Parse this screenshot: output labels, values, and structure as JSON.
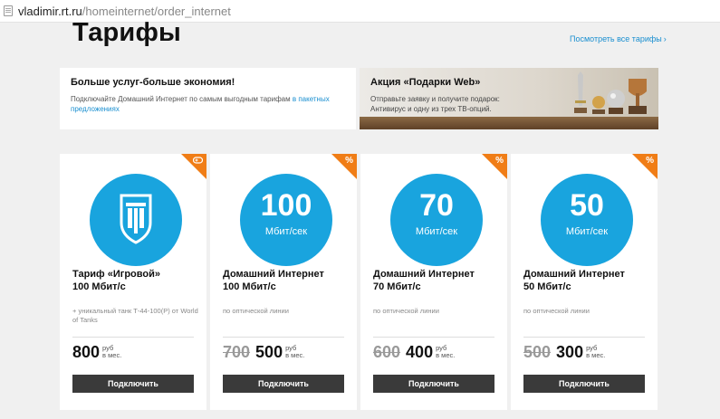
{
  "address_bar": {
    "host": "vladimir.rt.ru",
    "path": "/homeinternet/order_internet"
  },
  "page": {
    "title": "Тарифы",
    "all_tariffs_link": "Посмотреть все тарифы"
  },
  "promo_left": {
    "title": "Больше услуг-больше экономия!",
    "text": "Подключайте Домашний Интернет по самым выгодным тарифам ",
    "link": "в пакетных предложениях"
  },
  "promo_right": {
    "title": "Акция «Подарки Web»",
    "text": "Отправьте заявку и получите подарок: Антивирус и одну из трех ТВ-опций."
  },
  "colors": {
    "accent_blue": "#19a4de",
    "badge_orange": "#f07d16",
    "button_dark": "#3a3a3a",
    "link_blue": "#1a8fd0"
  },
  "tariffs": [
    {
      "badge_icon": "gamepad-icon",
      "circle_icon": "world-of-tanks-logo",
      "name_line1": "Тариф «Игровой»",
      "name_line2": "100 Мбит/с",
      "desc": "+ уникальный танк Т-44-100(Р) от World of Tanks",
      "price": "800",
      "price_unit": "руб",
      "price_period": "в мес.",
      "button": "Подключить"
    },
    {
      "badge_icon": "percent-icon",
      "badge": "%",
      "speed": "100",
      "speed_unit": "Мбит/сек",
      "name_line1": "Домашний Интернет",
      "name_line2": "100 Мбит/с",
      "desc": "по оптической линии",
      "old_price": "700",
      "price": "500",
      "price_unit": "руб",
      "price_period": "в мес.",
      "button": "Подключить"
    },
    {
      "badge_icon": "percent-icon",
      "badge": "%",
      "speed": "70",
      "speed_unit": "Мбит/сек",
      "name_line1": "Домашний Интернет",
      "name_line2": "70 Мбит/с",
      "desc": "по оптической линии",
      "old_price": "600",
      "price": "400",
      "price_unit": "руб",
      "price_period": "в мес.",
      "button": "Подключить"
    },
    {
      "badge_icon": "percent-icon",
      "badge": "%",
      "speed": "50",
      "speed_unit": "Мбит/сек",
      "name_line1": "Домашний Интернет",
      "name_line2": "50 Мбит/с",
      "desc": "по оптической линии",
      "old_price": "500",
      "price": "300",
      "price_unit": "руб",
      "price_period": "в мес.",
      "button": "Подключить"
    }
  ]
}
